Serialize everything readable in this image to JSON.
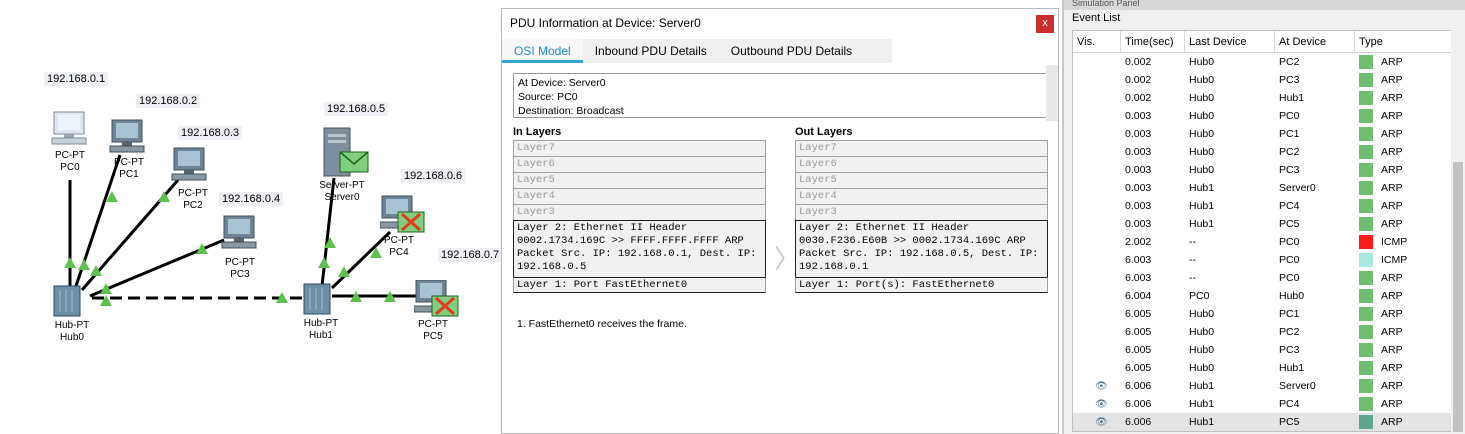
{
  "topology": {
    "ips": [
      "192.168.0.1",
      "192.168.0.2",
      "192.168.0.3",
      "192.168.0.4",
      "192.168.0.5",
      "192.168.0.6",
      "192.168.0.7"
    ],
    "devices": {
      "pc0": {
        "type": "PC-PT",
        "name": "PC0"
      },
      "pc1": {
        "type": "PC-PT",
        "name": "PC1"
      },
      "pc2": {
        "type": "PC-PT",
        "name": "PC2"
      },
      "pc3": {
        "type": "PC-PT",
        "name": "PC3"
      },
      "server0": {
        "type": "Server-PT",
        "name": "Server0"
      },
      "pc4": {
        "type": "PC-PT",
        "name": "PC4"
      },
      "pc5": {
        "type": "PC-PT",
        "name": "PC5"
      },
      "hub0": {
        "type": "Hub-PT",
        "name": "Hub0"
      },
      "hub1": {
        "type": "Hub-PT",
        "name": "Hub1"
      }
    }
  },
  "pdu": {
    "title": "PDU Information at Device: Server0",
    "close": "x",
    "tabs": [
      "OSI Model",
      "Inbound PDU Details",
      "Outbound PDU Details"
    ],
    "summary": [
      "At Device: Server0",
      "Source: PC0",
      "Destination: Broadcast"
    ],
    "in_layers_title": "In Layers",
    "out_layers_title": "Out Layers",
    "in_layers": {
      "upper": [
        "Layer7",
        "Layer6",
        "Layer5",
        "Layer4",
        "Layer3"
      ],
      "layer2": "Layer 2: Ethernet II Header\n0002.1734.169C >> FFFF.FFFF.FFFF ARP\nPacket Src. IP: 192.168.0.1, Dest. IP:\n192.168.0.5",
      "layer1": "Layer 1: Port FastEthernet0"
    },
    "out_layers": {
      "upper": [
        "Layer7",
        "Layer6",
        "Layer5",
        "Layer4",
        "Layer3"
      ],
      "layer2": "Layer 2: Ethernet II Header\n0030.F236.E60B >> 0002.1734.169C ARP\nPacket Src. IP: 192.168.0.5, Dest. IP:\n192.168.0.1",
      "layer1": "Layer 1: Port(s): FastEthernet0"
    },
    "description": "1. FastEthernet0 receives the frame."
  },
  "simulation": {
    "panel_title": "Simulation Panel",
    "event_list_label": "Event List",
    "columns": [
      "Vis.",
      "Time(sec)",
      "Last Device",
      "At Device",
      "Type"
    ],
    "type_colors": {
      "ARP": "#6fbf6f",
      "ICMP_red": "#ff1a1a",
      "ICMP_teal": "#a6eadf",
      "ARP_sel": "#5fa690"
    },
    "events": [
      {
        "vis": "",
        "time": "0.002",
        "last": "Hub0",
        "at": "PC2",
        "type": "ARP",
        "color": "#6fbf6f"
      },
      {
        "vis": "",
        "time": "0.002",
        "last": "Hub0",
        "at": "PC3",
        "type": "ARP",
        "color": "#6fbf6f"
      },
      {
        "vis": "",
        "time": "0.002",
        "last": "Hub0",
        "at": "Hub1",
        "type": "ARP",
        "color": "#6fbf6f"
      },
      {
        "vis": "",
        "time": "0.003",
        "last": "Hub0",
        "at": "PC0",
        "type": "ARP",
        "color": "#6fbf6f"
      },
      {
        "vis": "",
        "time": "0.003",
        "last": "Hub0",
        "at": "PC1",
        "type": "ARP",
        "color": "#6fbf6f"
      },
      {
        "vis": "",
        "time": "0.003",
        "last": "Hub0",
        "at": "PC2",
        "type": "ARP",
        "color": "#6fbf6f"
      },
      {
        "vis": "",
        "time": "0.003",
        "last": "Hub0",
        "at": "PC3",
        "type": "ARP",
        "color": "#6fbf6f"
      },
      {
        "vis": "",
        "time": "0.003",
        "last": "Hub1",
        "at": "Server0",
        "type": "ARP",
        "color": "#6fbf6f"
      },
      {
        "vis": "",
        "time": "0.003",
        "last": "Hub1",
        "at": "PC4",
        "type": "ARP",
        "color": "#6fbf6f"
      },
      {
        "vis": "",
        "time": "0.003",
        "last": "Hub1",
        "at": "PC5",
        "type": "ARP",
        "color": "#6fbf6f"
      },
      {
        "vis": "",
        "time": "2.002",
        "last": "--",
        "at": "PC0",
        "type": "ICMP",
        "color": "#ff1a1a"
      },
      {
        "vis": "",
        "time": "6.003",
        "last": "--",
        "at": "PC0",
        "type": "ICMP",
        "color": "#a6eadf"
      },
      {
        "vis": "",
        "time": "6.003",
        "last": "--",
        "at": "PC0",
        "type": "ARP",
        "color": "#6fbf6f"
      },
      {
        "vis": "",
        "time": "6.004",
        "last": "PC0",
        "at": "Hub0",
        "type": "ARP",
        "color": "#6fbf6f"
      },
      {
        "vis": "",
        "time": "6.005",
        "last": "Hub0",
        "at": "PC1",
        "type": "ARP",
        "color": "#6fbf6f"
      },
      {
        "vis": "",
        "time": "6.005",
        "last": "Hub0",
        "at": "PC2",
        "type": "ARP",
        "color": "#6fbf6f"
      },
      {
        "vis": "",
        "time": "6.005",
        "last": "Hub0",
        "at": "PC3",
        "type": "ARP",
        "color": "#6fbf6f"
      },
      {
        "vis": "",
        "time": "6.005",
        "last": "Hub0",
        "at": "Hub1",
        "type": "ARP",
        "color": "#6fbf6f"
      },
      {
        "vis": "eye",
        "time": "6.006",
        "last": "Hub1",
        "at": "Server0",
        "type": "ARP",
        "color": "#6fbf6f"
      },
      {
        "vis": "eye",
        "time": "6.006",
        "last": "Hub1",
        "at": "PC4",
        "type": "ARP",
        "color": "#6fbf6f"
      },
      {
        "vis": "eye",
        "time": "6.006",
        "last": "Hub1",
        "at": "PC5",
        "type": "ARP",
        "color": "#5fa690",
        "selected": true
      }
    ]
  }
}
